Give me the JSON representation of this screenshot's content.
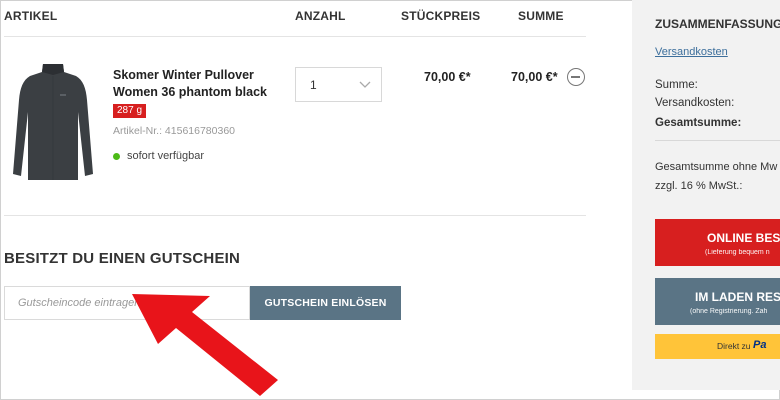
{
  "table": {
    "headers": {
      "article": "ARTIKEL",
      "quantity": "ANZAHL",
      "unit_price": "STÜCKPREIS",
      "total": "SUMME"
    }
  },
  "product": {
    "name": "Skomer Winter Pullover Women 36 phantom black",
    "weight": "287 g",
    "article_number": "Artikel-Nr.: 415616780360",
    "availability": "sofort verfügbar",
    "quantity": "1",
    "unit_price": "70,00 €*",
    "total": "70,00 €*",
    "image_icon": "turtleneck-pullover-image"
  },
  "voucher": {
    "title": "BESITZT DU EINEN GUTSCHEIN",
    "placeholder": "Gutscheincode eintragen",
    "button": "GUTSCHEIN EINLÖSEN"
  },
  "summary": {
    "title": "ZUSAMMENFASSUNG",
    "shipping_link": "Versandkosten",
    "sum_label": "Summe:",
    "shipping_label": "Versandkosten:",
    "grand_total_label": "Gesamtsumme:",
    "net_label": "Gesamtsumme ohne Mw",
    "vat_label": "zzgl. 16 % MwSt.:",
    "online_button": "ONLINE BEST",
    "online_sub": "(Lieferung bequem n",
    "store_button": "IM LADEN RESE",
    "store_sub": "(ohne Registrierung. Zah",
    "paypal_label": "Direkt zu",
    "paypal_logo": "Pa"
  },
  "colors": {
    "accent_red": "#d71f1f",
    "button_slate": "#5a7485",
    "paypal_yellow": "#ffc439",
    "availability_green": "#4cbb17",
    "annotation_arrow": "#e8141a"
  }
}
